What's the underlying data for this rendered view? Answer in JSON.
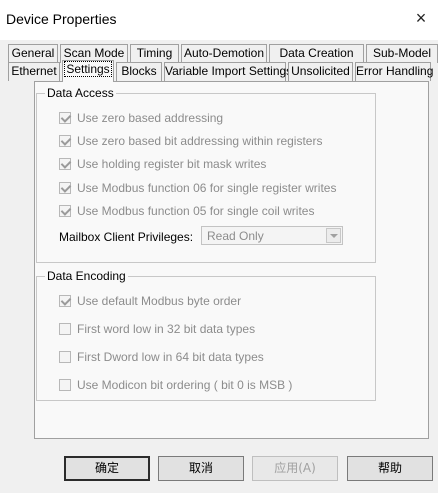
{
  "window": {
    "title": "Device Properties",
    "close_glyph": "×"
  },
  "tabs": {
    "row1": [
      "General",
      "Scan Mode",
      "Timing",
      "Auto-Demotion",
      "Data Creation",
      "Sub-Model"
    ],
    "row2": [
      "Ethernet",
      "Settings",
      "Blocks",
      "Variable Import Settings",
      "Unsolicited",
      "Error Handling"
    ],
    "active": "Settings"
  },
  "data_access": {
    "legend": "Data Access",
    "options": [
      {
        "label": "Use zero based addressing",
        "checked": true,
        "enabled": false
      },
      {
        "label": "Use zero based bit addressing within registers",
        "checked": true,
        "enabled": false
      },
      {
        "label": "Use holding register bit mask writes",
        "checked": true,
        "enabled": false
      },
      {
        "label": "Use Modbus function 06 for single register writes",
        "checked": true,
        "enabled": false
      },
      {
        "label": "Use Modbus function 05 for single coil writes",
        "checked": true,
        "enabled": false
      }
    ],
    "mailbox_label": "Mailbox Client Privileges:",
    "mailbox_value": "Read Only"
  },
  "data_encoding": {
    "legend": "Data Encoding",
    "options": [
      {
        "label": "Use default Modbus byte order",
        "checked": true,
        "enabled": false
      },
      {
        "label": "First word low in 32 bit data types",
        "checked": false,
        "enabled": false
      },
      {
        "label": "First Dword low in 64 bit data types",
        "checked": false,
        "enabled": false
      },
      {
        "label": "Use Modicon bit ordering ( bit 0 is MSB )",
        "checked": false,
        "enabled": false
      }
    ]
  },
  "buttons": {
    "ok": "确定",
    "cancel": "取消",
    "apply": "应用(A)",
    "help": "帮助"
  },
  "icons": {
    "close": "close-icon",
    "dropdown": "chevron-down-icon"
  }
}
